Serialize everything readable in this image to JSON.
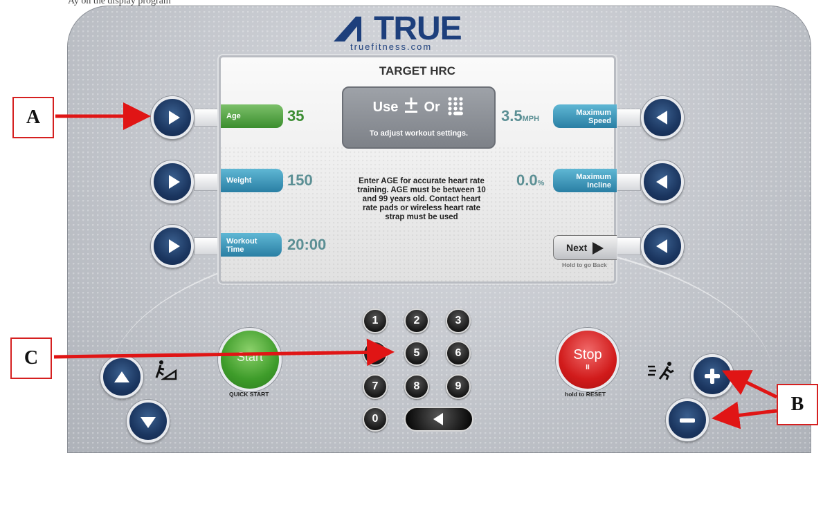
{
  "caption_top": "Ay on the display program",
  "brand": {
    "name": "TRUE",
    "url": "truefitness.com"
  },
  "screen": {
    "title": "TARGET HRC",
    "hint_use": "Use",
    "hint_or": "Or",
    "hint_sub": "To adjust workout settings.",
    "message": "Enter AGE for accurate heart rate training. AGE must be between 10 and 99 years old. Contact heart rate pads or wireless heart rate strap must be used",
    "fields_left": [
      {
        "label": "Age",
        "value": "35"
      },
      {
        "label": "Weight",
        "value": "150"
      },
      {
        "label": "Workout Time",
        "value": "20:00"
      }
    ],
    "fields_right": [
      {
        "label": "Maximum Speed",
        "value": "3.5",
        "unit": "MPH"
      },
      {
        "label": "Maximum Incline",
        "value": "0.0",
        "unit": "%"
      }
    ],
    "next_label": "Next",
    "next_hint": "Hold to go Back"
  },
  "controls": {
    "start_label": "Start",
    "start_caption": "QUICK START",
    "stop_label": "Stop",
    "stop_pause": "II",
    "stop_caption": "hold to RESET",
    "keypad": [
      "1",
      "2",
      "3",
      "4",
      "5",
      "6",
      "7",
      "8",
      "9",
      "0"
    ]
  },
  "annotations": {
    "a": "A",
    "b": "B",
    "c": "C"
  },
  "colors": {
    "annotation_red": "#e01515",
    "button_navy": "#1b3660",
    "brand_blue": "#1d3f7c"
  }
}
